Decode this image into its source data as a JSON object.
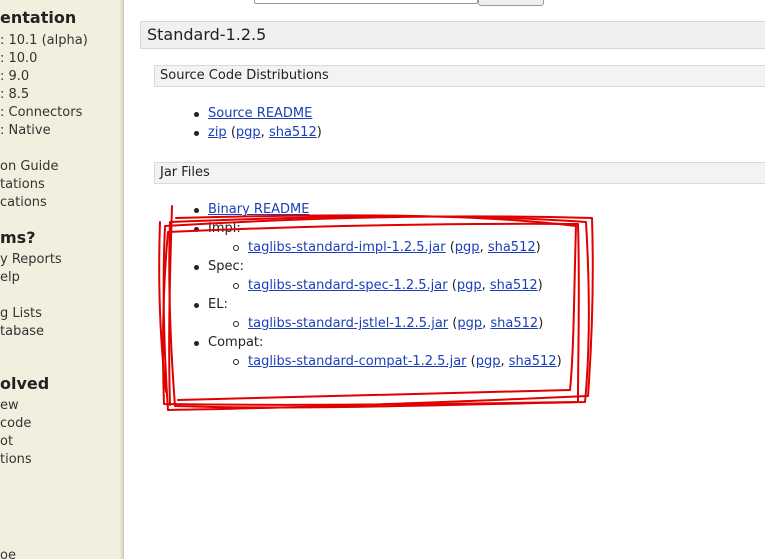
{
  "sidebar": {
    "sections": [
      {
        "heading": "entation",
        "items": [
          ": 10.1 (alpha)",
          ": 10.0",
          ": 9.0",
          ": 8.5",
          ": Connectors",
          ": Native",
          "",
          "on Guide",
          "tations",
          "cations"
        ]
      },
      {
        "heading": "ms?",
        "items": [
          "y Reports",
          "elp",
          "",
          "g Lists",
          "tabase"
        ]
      },
      {
        "heading": "olved",
        "items": [
          "ew",
          " code",
          "ot",
          "tions"
        ]
      }
    ],
    "bottom_fragment": "oe"
  },
  "main": {
    "section_title": "Standard-1.2.5",
    "source_dist": {
      "title": "Source Code Distributions",
      "readme_label": "Source README",
      "zip": {
        "label": "zip",
        "pgp": "pgp",
        "sha": "sha512"
      }
    },
    "jar_files": {
      "title": "Jar Files",
      "readme_label": "Binary README",
      "groups": [
        {
          "label": "Impl:",
          "file": "taglibs-standard-impl-1.2.5.jar",
          "pgp": "pgp",
          "sha": "sha512"
        },
        {
          "label": "Spec:",
          "file": "taglibs-standard-spec-1.2.5.jar",
          "pgp": "pgp",
          "sha": "sha512"
        },
        {
          "label": "EL:",
          "file": "taglibs-standard-jstlel-1.2.5.jar",
          "pgp": "pgp",
          "sha": "sha512"
        },
        {
          "label": "Compat:",
          "file": "taglibs-standard-compat-1.2.5.jar",
          "pgp": "pgp",
          "sha": "sha512"
        }
      ]
    }
  },
  "annotation": {
    "color": "#e00000"
  }
}
